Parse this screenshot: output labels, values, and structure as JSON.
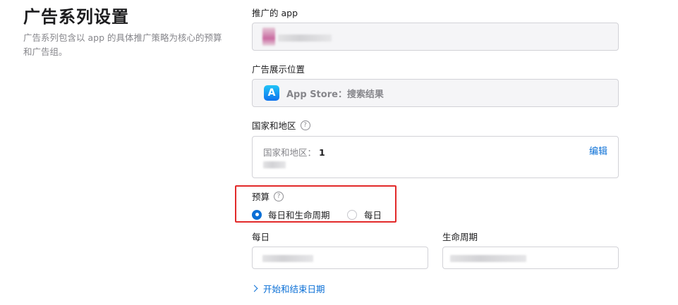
{
  "section": {
    "title": "广告系列设置",
    "description": "广告系列包含以 app 的具体推广策略为核心的预算和广告组。"
  },
  "app_field": {
    "label": "推广的 app"
  },
  "placement_field": {
    "label": "广告展示位置",
    "value": "App Store：搜索结果",
    "icon": "app-store-icon"
  },
  "countries_field": {
    "label": "国家和地区",
    "summary_label": "国家和地区：",
    "summary_count": "1",
    "edit_label": "编辑"
  },
  "budget": {
    "label": "预算",
    "options": [
      {
        "label": "每日和生命周期",
        "selected": true
      },
      {
        "label": "每日",
        "selected": false
      }
    ]
  },
  "daily_field": {
    "label": "每日"
  },
  "lifetime_field": {
    "label": "生命周期"
  },
  "dates_link": {
    "label": "开始和结束日期"
  },
  "colors": {
    "accent": "#0a6fd6",
    "highlight": "#e22a2a"
  }
}
